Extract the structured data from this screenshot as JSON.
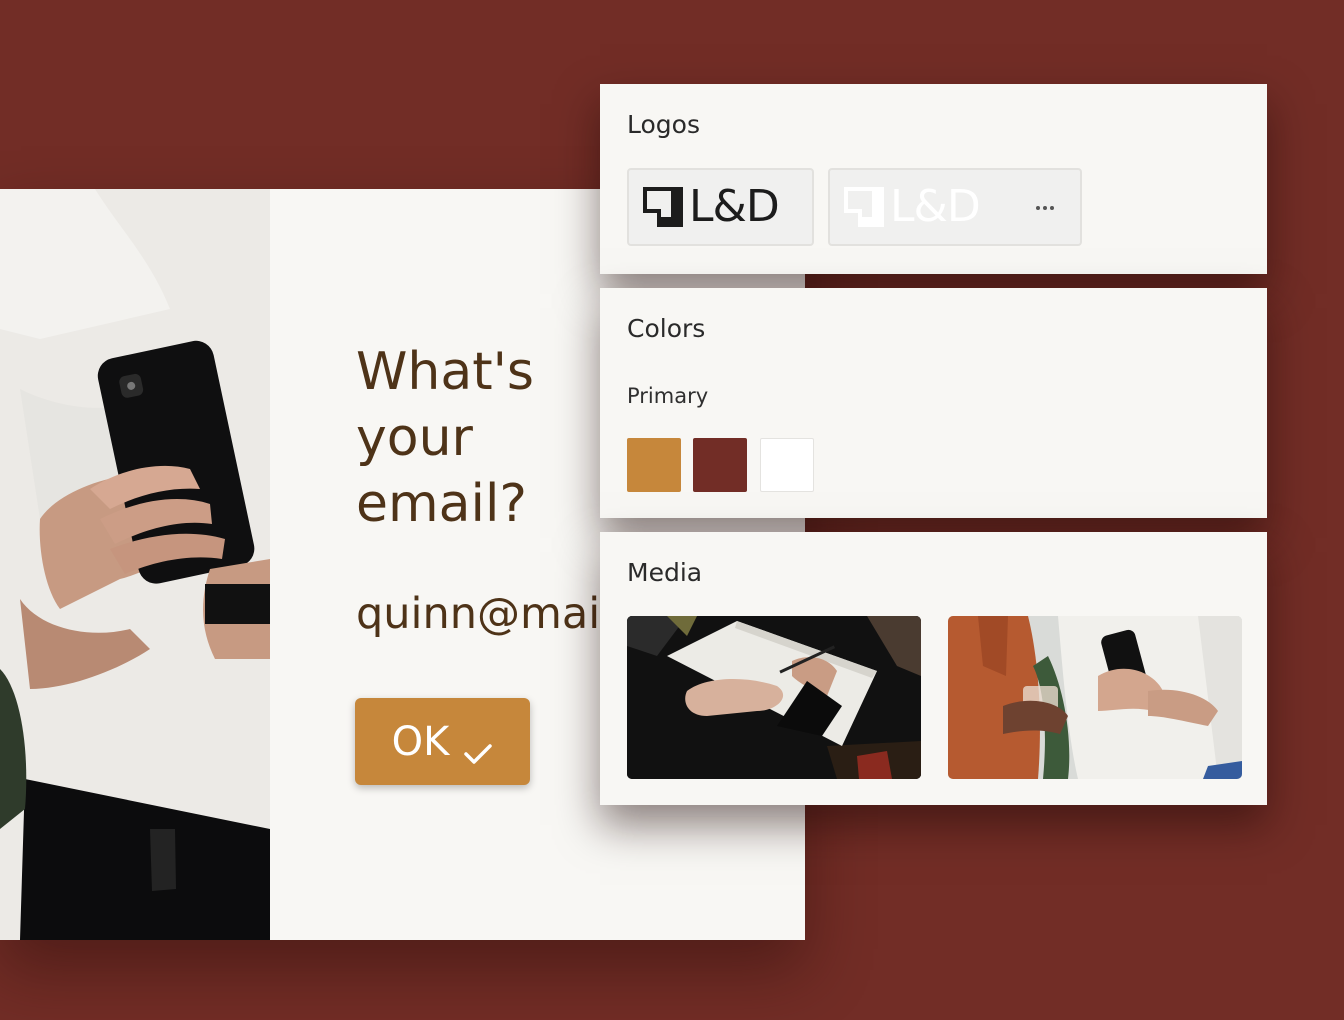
{
  "form": {
    "question": "What's your email?",
    "email_value": "quinn@mail",
    "ok_label": "OK",
    "button_color": "#c6873b",
    "text_color": "#4e3318"
  },
  "brand_panel": {
    "logos": {
      "title": "Logos",
      "items": [
        {
          "text": "L&D",
          "variant": "dark"
        },
        {
          "text": "L&D",
          "variant": "light"
        }
      ],
      "more_icon": "more-horizontal-icon"
    },
    "colors": {
      "title": "Colors",
      "primary_label": "Primary",
      "swatches": [
        "#c6873b",
        "#722d26",
        "#ffffff"
      ]
    },
    "media": {
      "title": "Media",
      "items": [
        "notebook-writing-photo",
        "people-with-phone-photo"
      ]
    }
  },
  "background_color": "#722d26"
}
